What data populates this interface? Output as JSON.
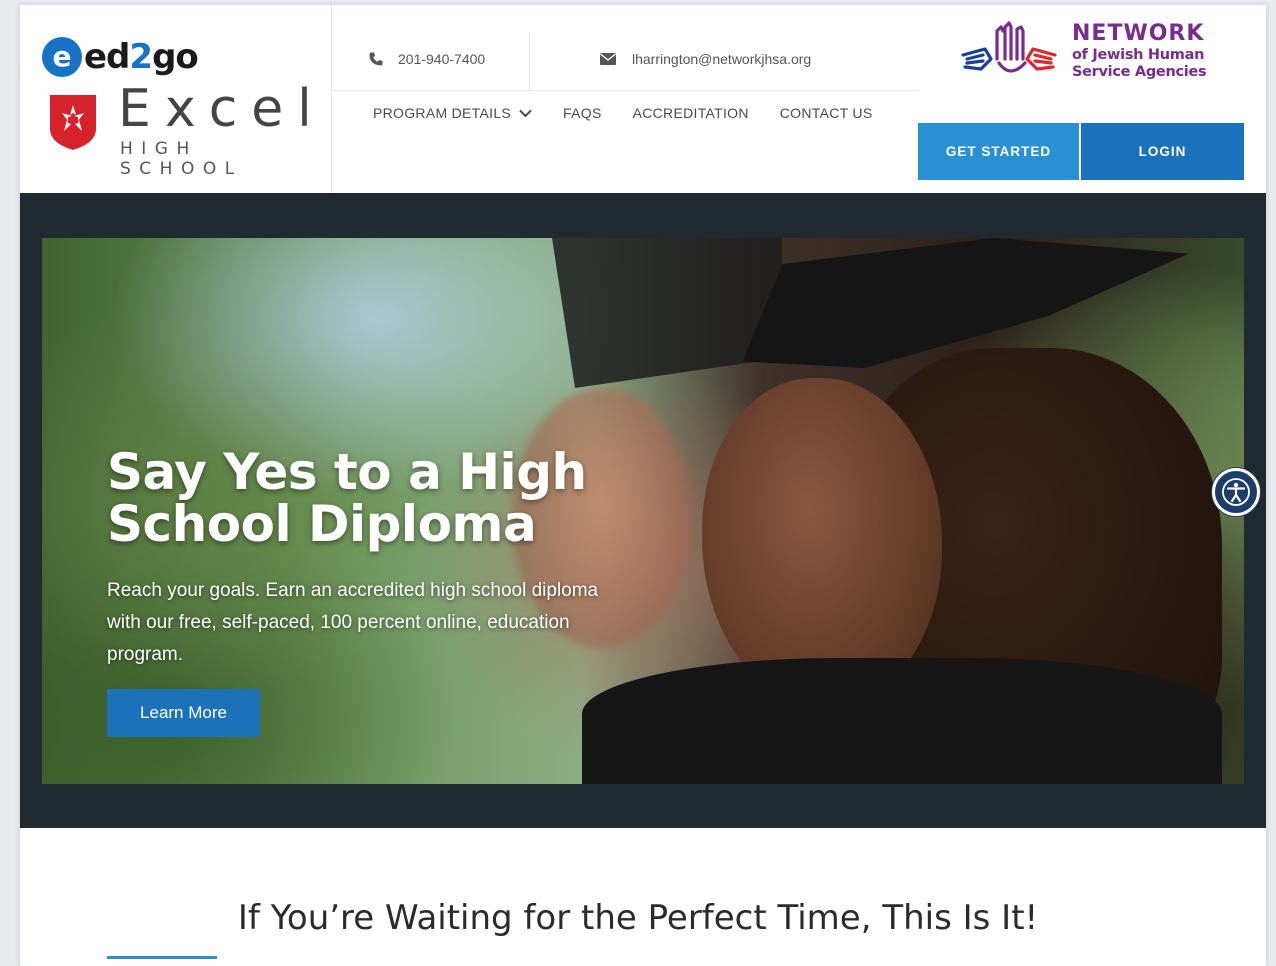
{
  "brand": {
    "ed2go_icon": "e",
    "ed2go_prefix": "ed",
    "ed2go_two": "2",
    "ed2go_suffix": "go",
    "excel": "Excel",
    "high_school": "HIGH SCHOOL",
    "network_title": "NETWORK",
    "network_line1": "of Jewish Human",
    "network_line2": "Service Agencies"
  },
  "contact": {
    "phone": "201-940-7400",
    "phone_icon": "phone-icon",
    "email": "lharrington@networkjhsa.org",
    "email_icon": "envelope-icon"
  },
  "nav": {
    "items": [
      {
        "label": "PROGRAM DETAILS",
        "has_dropdown": true
      },
      {
        "label": "FAQS"
      },
      {
        "label": "ACCREDITATION"
      },
      {
        "label": "CONTACT US"
      }
    ]
  },
  "actions": {
    "get_started": "GET STARTED",
    "login": "LOGIN"
  },
  "hero": {
    "title": "Say Yes to a High School Diploma",
    "text": "Reach your goals. Earn an accredited high school diploma with our free, self-paced, 100 percent online, education program.",
    "button": "Learn More"
  },
  "section": {
    "title": "If You’re Waiting for the Perfect Time, This Is It!"
  },
  "colors": {
    "primary_blue": "#1b72b9",
    "light_blue": "#2b8fd3",
    "hero_frame": "#212a30",
    "network_purple": "#7a2c8c"
  }
}
